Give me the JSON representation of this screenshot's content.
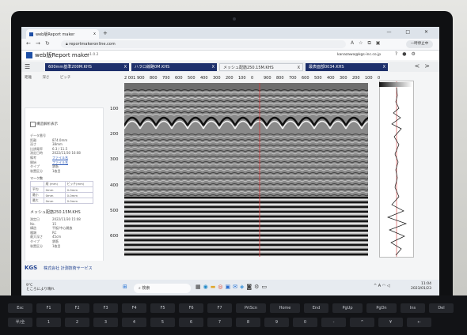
{
  "browser": {
    "tab_title": "web版Report maker",
    "tab_close": "x",
    "new_tab": "+",
    "url": "reportmakeronline.com",
    "win_controls": [
      "—",
      "□",
      "✕"
    ],
    "profile_label": "一時停止中"
  },
  "app": {
    "title": "web版Report maker",
    "version": "v 1.0.2",
    "user_email": "kanazawa@kgs-inc.co.jp",
    "menu_icon": "menu-icon",
    "header_icons": [
      "help-icon",
      "notifications-icon",
      "settings-icon"
    ]
  },
  "file_tabs": [
    {
      "label": "600mm基準200M.KHS",
      "close": "X",
      "active": false
    },
    {
      "label": "ハラロ線路0M.KHS",
      "close": "X",
      "active": false
    },
    {
      "label": "メッシュ配筋250.15M.KHS",
      "close": "X",
      "active": true
    },
    {
      "label": "最表面部0034.KHS",
      "close": "X",
      "active": false
    }
  ],
  "toolbar": {
    "items": [
      "距離",
      "深さ",
      "ピッチ"
    ],
    "prev_arrow": "<",
    "next_arrow": ">"
  },
  "left_panel": {
    "checkbox_label": "構造解析表示",
    "props": [
      {
        "k": "データ番号",
        "v": "",
        "link": false
      },
      {
        "k": "距離",
        "v": "874.0mm",
        "link": false
      },
      {
        "k": "深さ",
        "v": "38mm",
        "link": false
      },
      {
        "k": "比誘電率",
        "v": "6.3 / 11.5",
        "link": false
      },
      {
        "k": "測定日時",
        "v": "2022/11/30 16:08",
        "link": false
      },
      {
        "k": "備考",
        "v": "ファイル名",
        "link": true
      },
      {
        "k": "開始",
        "v": "ファイル名",
        "link": true
      },
      {
        "k": "タイプ",
        "v": "鉄筋",
        "link": false
      },
      {
        "k": "装置区分",
        "v": "1枚目",
        "link": false
      }
    ],
    "grid_title": "マーク数",
    "grid_headers": [
      "",
      "縦 (mm)",
      "ピッチ(mm)"
    ],
    "grid_rows": [
      [
        "平均",
        "0mm",
        "0.0mm"
      ],
      [
        "最小",
        "0mm",
        "0.0mm"
      ],
      [
        "最大",
        "0mm",
        "0.0mm"
      ]
    ],
    "file_section_title": "メッシュ配筋250.15M.KHS",
    "file_props": [
      {
        "k": "測定日",
        "v": "2022/11/30 15:08"
      },
      {
        "k": "No.",
        "v": "15"
      },
      {
        "k": "構造",
        "v": "平板/中心開放"
      },
      {
        "k": "種類",
        "v": "RC"
      },
      {
        "k": "最大深さ",
        "v": "45cm"
      },
      {
        "k": "タイプ",
        "v": "鉄筋"
      },
      {
        "k": "装置区分",
        "v": "1枚目"
      }
    ]
  },
  "ruler": {
    "labels": [
      "2 001",
      "900",
      "800",
      "700",
      "600",
      "500",
      "400",
      "300",
      "200",
      "100",
      "0",
      "900",
      "800",
      "700",
      "600",
      "500",
      "400",
      "300",
      "200",
      "100",
      "0"
    ]
  },
  "depth_axis": {
    "labels": [
      "100",
      "200",
      "300",
      "400",
      "500",
      "600"
    ]
  },
  "footer": {
    "brand": "KGS",
    "company": "株式会社 計測技術サービス"
  },
  "taskbar": {
    "weather_temp": "9°C",
    "weather_desc": "ところにより晴れ",
    "search_placeholder": "検索",
    "tray_lang": "A",
    "time": "11:04",
    "date": "2023/01/23"
  },
  "keyboard": {
    "row1": [
      "Esc",
      "F1",
      "F2",
      "F3",
      "F4",
      "F5",
      "F6",
      "F7",
      "PrtScn",
      "Home",
      "End",
      "PgUp",
      "PgDn",
      "Ins",
      "Del"
    ],
    "row2": [
      "半/全",
      "1",
      "2",
      "3",
      "4",
      "5",
      "6",
      "7",
      "8",
      "9",
      "0",
      "-",
      "^",
      "¥",
      "←"
    ]
  }
}
